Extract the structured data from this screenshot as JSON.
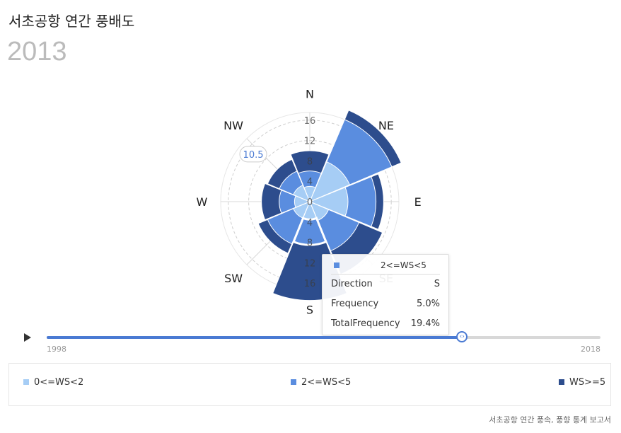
{
  "header": {
    "title": "서초공항 연간 풍배도",
    "year": "2013"
  },
  "chart_data": {
    "type": "windrose",
    "directions": [
      "N",
      "NE",
      "E",
      "SE",
      "S",
      "SW",
      "W",
      "NW"
    ],
    "radial_ticks": [
      "0",
      "4",
      "8",
      "12",
      "16"
    ],
    "series": [
      {
        "name": "0<=WS<2",
        "color": "#a6cdf5",
        "values": [
          3.0,
          8.5,
          7.5,
          4.0,
          3.5,
          3.5,
          3.0,
          3.5
        ]
      },
      {
        "name": "2<=WS<5",
        "color": "#5a8ddf",
        "values": [
          3.0,
          9.0,
          5.5,
          6.5,
          5.0,
          5.5,
          3.0,
          3.0
        ]
      },
      {
        "name": "WS>=5",
        "color": "#2d4d8d",
        "values": [
          4.0,
          2.0,
          1.5,
          5.0,
          10.9,
          2.0,
          3.5,
          2.5
        ]
      }
    ],
    "hover_label": "10.5"
  },
  "tooltip": {
    "series": "2<=WS<5",
    "rows": [
      {
        "key": "Direction",
        "value": "S"
      },
      {
        "key": "Frequency",
        "value": "5.0%"
      },
      {
        "key": "TotalFrequency",
        "value": "19.4%"
      }
    ]
  },
  "timeline": {
    "start": "1998",
    "end": "2018",
    "progress": 0.75
  },
  "legend": [
    "0<=WS<2",
    "2<=WS<5",
    "WS>=5"
  ],
  "source": "서초공항 연간 풍속, 풍향 통계 보고서"
}
